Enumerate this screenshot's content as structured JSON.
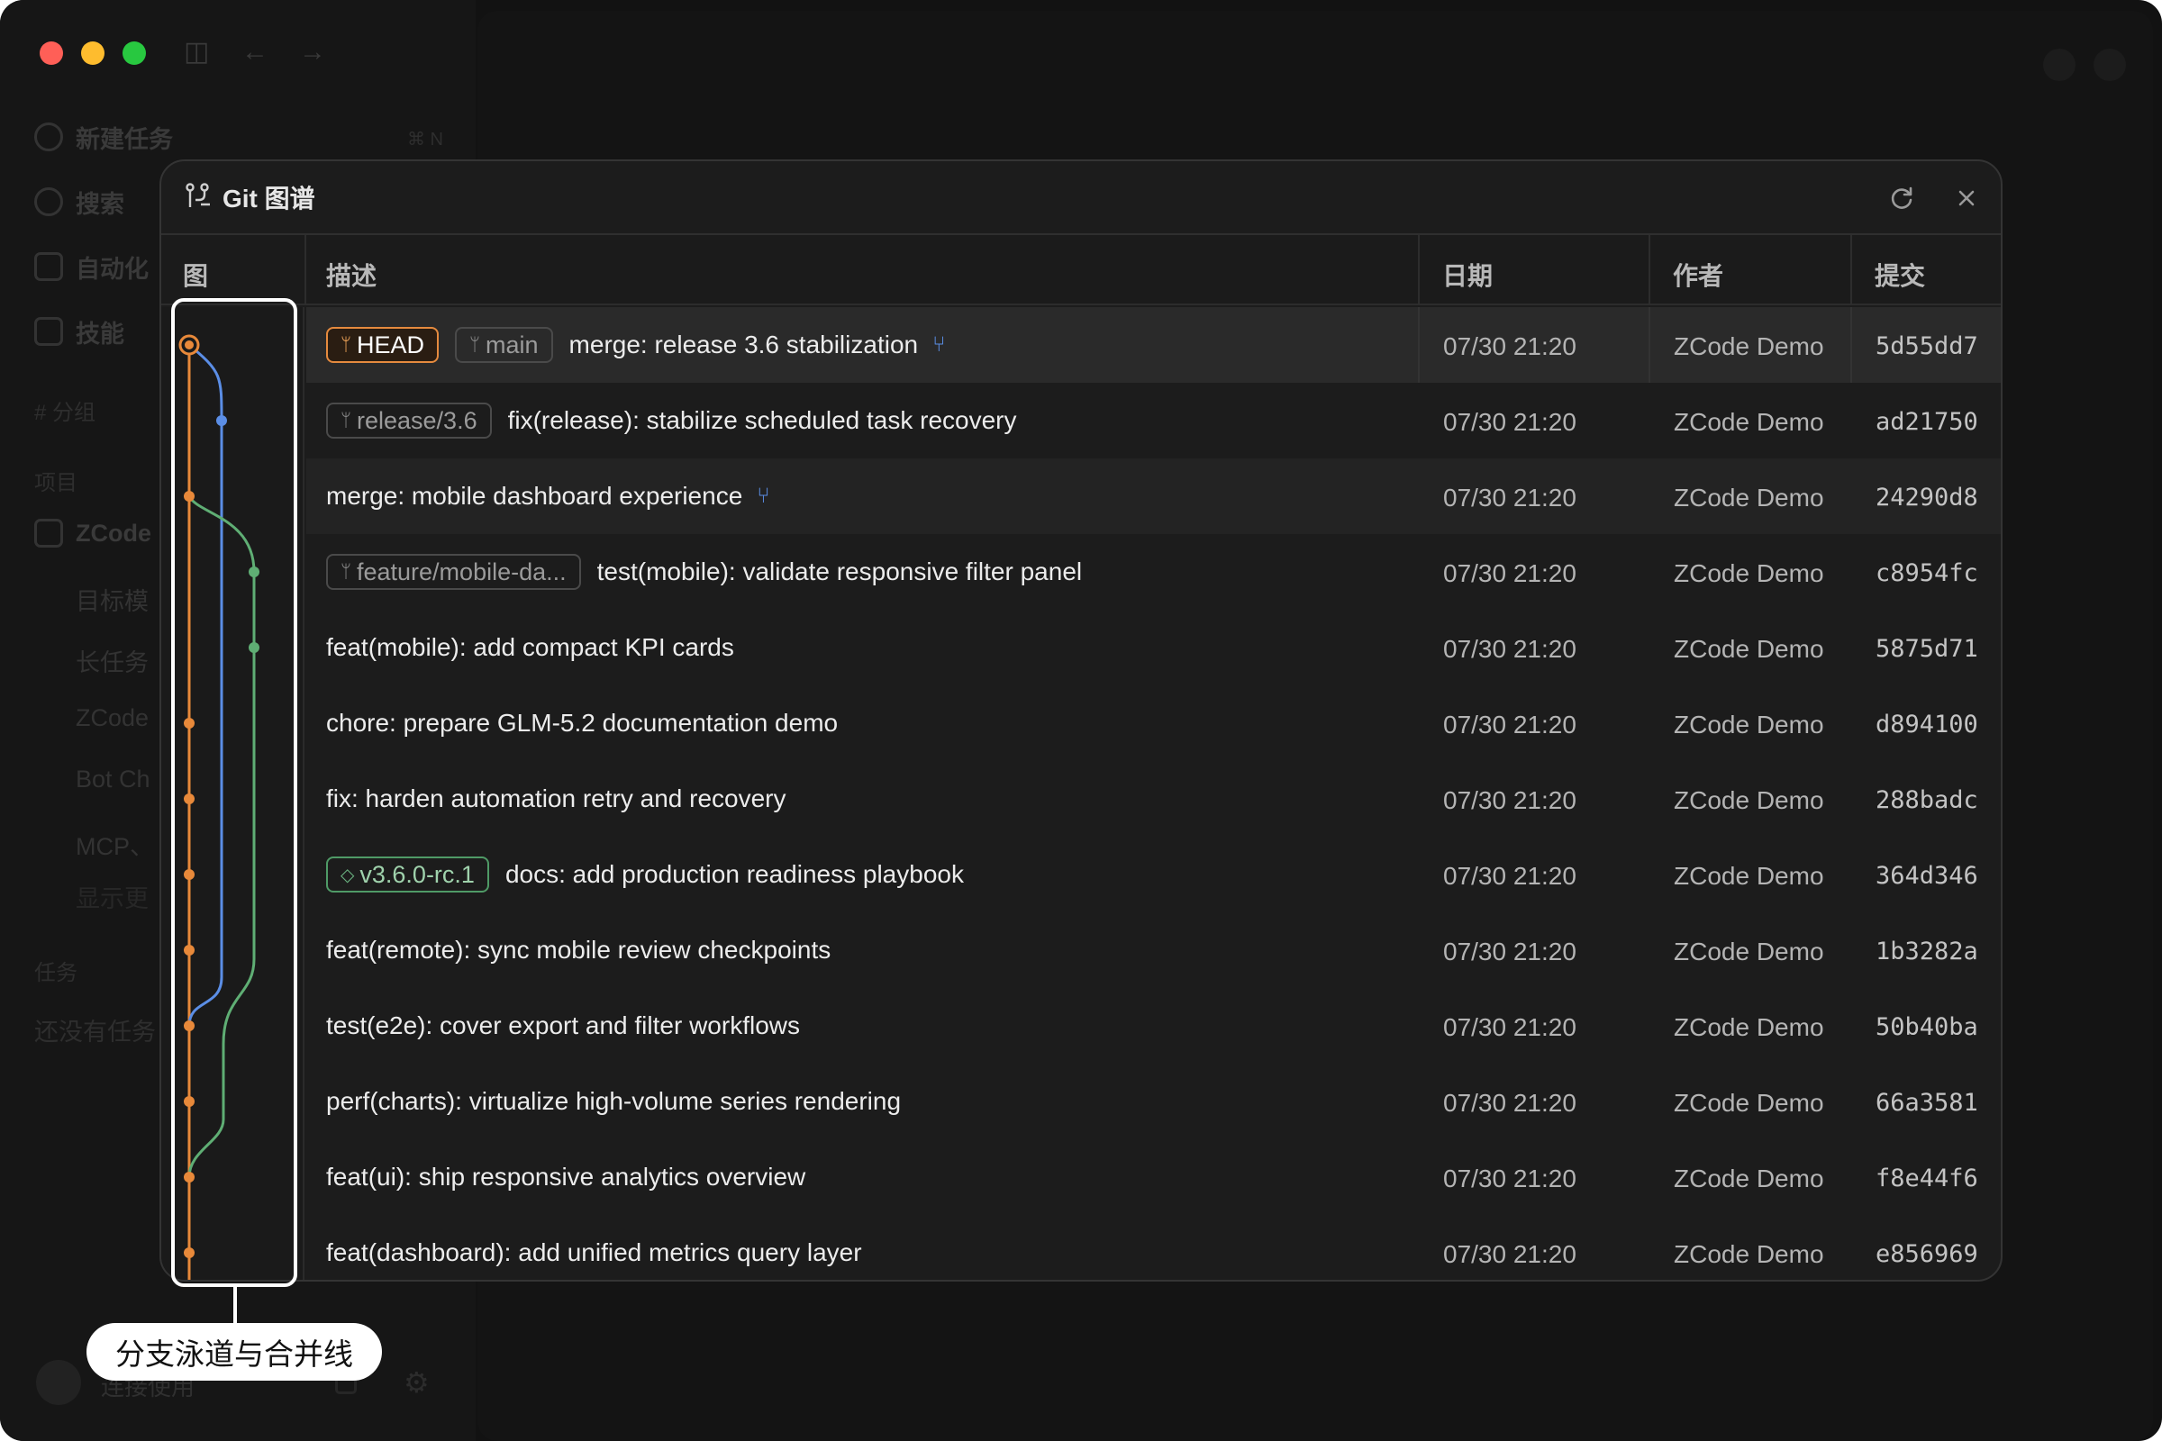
{
  "sidebar": {
    "new_task": "新建任务",
    "new_task_shortcut": "⌘ N",
    "search": "搜索",
    "automation": "自动化",
    "skills": "技能",
    "group_label": "# 分组",
    "projects_label": "项目",
    "project_name": "ZCode",
    "project_items": [
      "目标模",
      "长任务",
      "ZCode",
      "Bot Ch",
      "MCP、",
      "显示更"
    ],
    "tasks_label": "任务",
    "no_tasks": "还没有任务",
    "user_name": "连接使用"
  },
  "modal": {
    "title": "Git 图谱",
    "columns": {
      "graph": "图",
      "description": "描述",
      "date": "日期",
      "author": "作者",
      "commit": "提交"
    },
    "commits": [
      {
        "badges": [
          {
            "type": "head",
            "label": "HEAD"
          },
          {
            "type": "branch",
            "label": "main"
          }
        ],
        "message": "merge: release 3.6 stabilization",
        "merge": true,
        "date": "07/30 21:20",
        "author": "ZCode Demo",
        "hash": "5d55dd7"
      },
      {
        "badges": [
          {
            "type": "branch",
            "label": "release/3.6"
          }
        ],
        "message": "fix(release): stabilize scheduled task recovery",
        "merge": false,
        "date": "07/30 21:20",
        "author": "ZCode Demo",
        "hash": "ad21750"
      },
      {
        "badges": [],
        "message": "merge: mobile dashboard experience",
        "merge": true,
        "date": "07/30 21:20",
        "author": "ZCode Demo",
        "hash": "24290d8"
      },
      {
        "badges": [
          {
            "type": "branch",
            "label": "feature/mobile-da..."
          }
        ],
        "message": "test(mobile): validate responsive filter panel",
        "merge": false,
        "date": "07/30 21:20",
        "author": "ZCode Demo",
        "hash": "c8954fc"
      },
      {
        "badges": [],
        "message": "feat(mobile): add compact KPI cards",
        "merge": false,
        "date": "07/30 21:20",
        "author": "ZCode Demo",
        "hash": "5875d71"
      },
      {
        "badges": [],
        "message": "chore: prepare GLM-5.2 documentation demo",
        "merge": false,
        "date": "07/30 21:20",
        "author": "ZCode Demo",
        "hash": "d894100"
      },
      {
        "badges": [],
        "message": "fix: harden automation retry and recovery",
        "merge": false,
        "date": "07/30 21:20",
        "author": "ZCode Demo",
        "hash": "288badc"
      },
      {
        "badges": [
          {
            "type": "tag",
            "label": "v3.6.0-rc.1"
          }
        ],
        "message": "docs: add production readiness playbook",
        "merge": false,
        "date": "07/30 21:20",
        "author": "ZCode Demo",
        "hash": "364d346"
      },
      {
        "badges": [],
        "message": "feat(remote): sync mobile review checkpoints",
        "merge": false,
        "date": "07/30 21:20",
        "author": "ZCode Demo",
        "hash": "1b3282a"
      },
      {
        "badges": [],
        "message": "test(e2e): cover export and filter workflows",
        "merge": false,
        "date": "07/30 21:20",
        "author": "ZCode Demo",
        "hash": "50b40ba"
      },
      {
        "badges": [],
        "message": "perf(charts): virtualize high-volume series rendering",
        "merge": false,
        "date": "07/30 21:20",
        "author": "ZCode Demo",
        "hash": "66a3581"
      },
      {
        "badges": [],
        "message": "feat(ui): ship responsive analytics overview",
        "merge": false,
        "date": "07/30 21:20",
        "author": "ZCode Demo",
        "hash": "f8e44f6"
      },
      {
        "badges": [],
        "message": "feat(dashboard): add unified metrics query layer",
        "merge": false,
        "date": "07/30 21:20",
        "author": "ZCode Demo",
        "hash": "e856969"
      }
    ]
  },
  "callout": {
    "label": "分支泳道与合并线"
  },
  "colors": {
    "lane_main": "#e8893a",
    "lane_release": "#5b8ee6",
    "lane_feature": "#5fae74"
  }
}
